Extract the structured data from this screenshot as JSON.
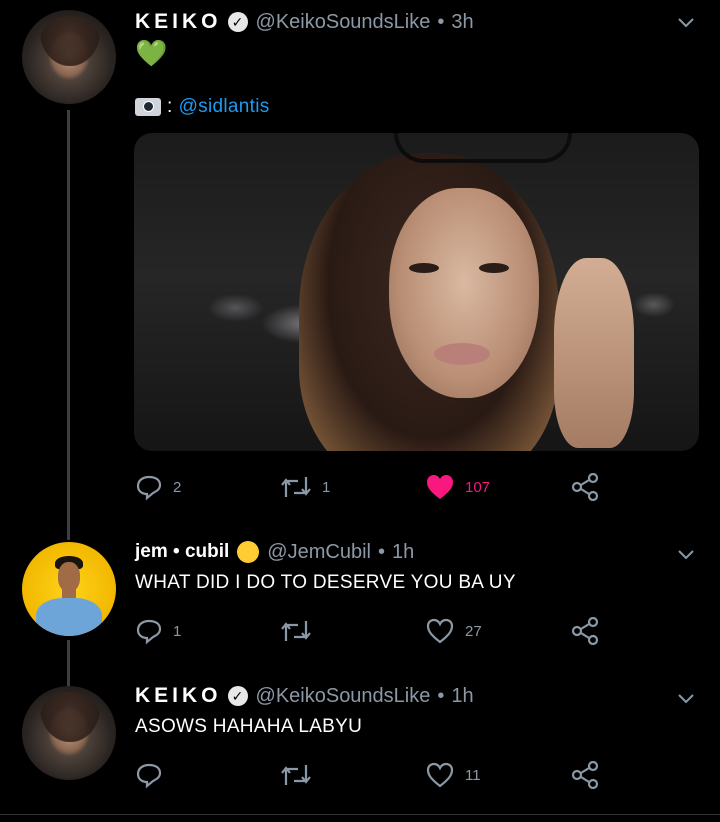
{
  "tweets": [
    {
      "name": "KEIKO",
      "handle": "@KeikoSoundsLike",
      "time": "3h",
      "emoji": "💚",
      "credit_mention": "@sidlantis",
      "credit_sep": ":",
      "replies": "2",
      "retweets": "1",
      "likes": "107"
    },
    {
      "name": "jem • cubil",
      "handle": "@JemCubil",
      "time": "1h",
      "text": "WHAT DID I DO TO DESERVE YOU BA UY",
      "replies": "1",
      "retweets": "",
      "likes": "27"
    },
    {
      "name": "KEIKO",
      "handle": "@KeikoSoundsLike",
      "time": "1h",
      "text": "ASOWS HAHAHA LABYU",
      "replies": "",
      "retweets": "",
      "likes": "11"
    }
  ],
  "colors": {
    "background": "#000000",
    "muted": "#8b98a5",
    "link": "#1d9bf0",
    "like": "#f91880"
  },
  "icons": [
    "verified-icon",
    "camera-icon",
    "reply-icon",
    "retweet-icon",
    "like-icon",
    "share-icon",
    "chevron-down-icon"
  ]
}
